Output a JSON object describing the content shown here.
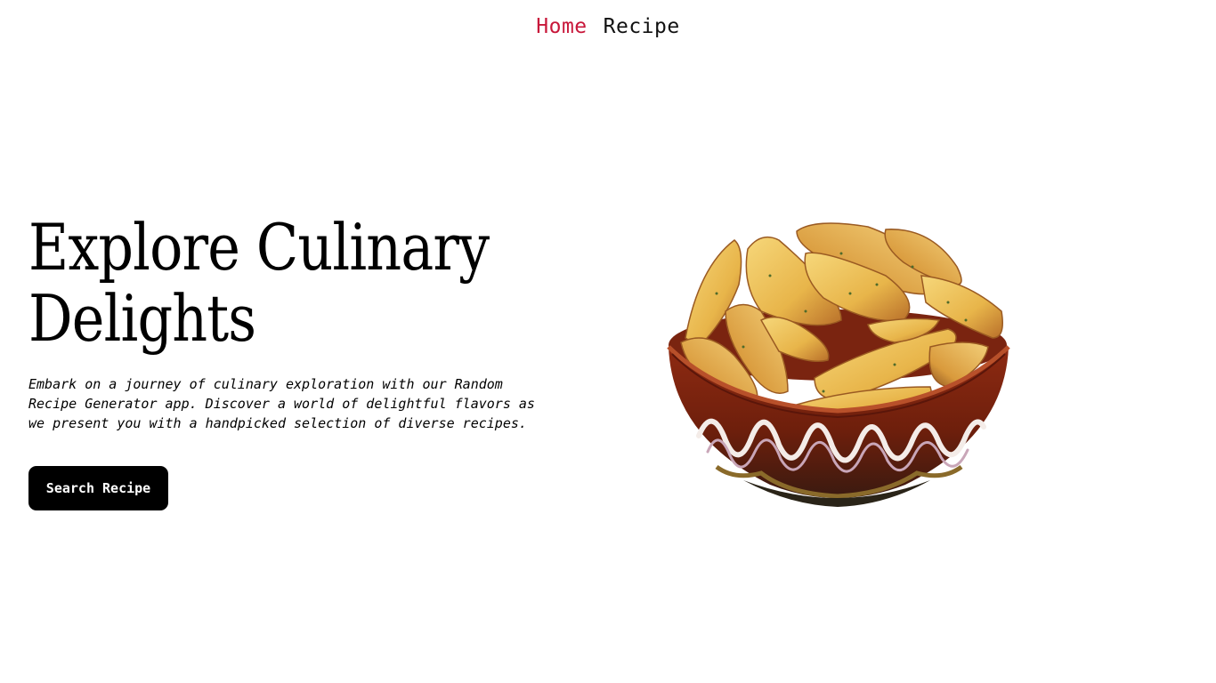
{
  "nav": {
    "items": [
      {
        "label": "Home",
        "active": true
      },
      {
        "label": "Recipe",
        "active": false
      }
    ],
    "active_color": "#c8173a"
  },
  "hero": {
    "title_line1": "Explore Culinary",
    "title_line2": "Delights",
    "description": "Embark on a journey of culinary exploration with our Random Recipe Generator app. Discover a world of delightful flavors as we present you with a handpicked selection of diverse recipes.",
    "button_label": "Search Recipe",
    "image": "bowl-of-potato-wedges"
  }
}
